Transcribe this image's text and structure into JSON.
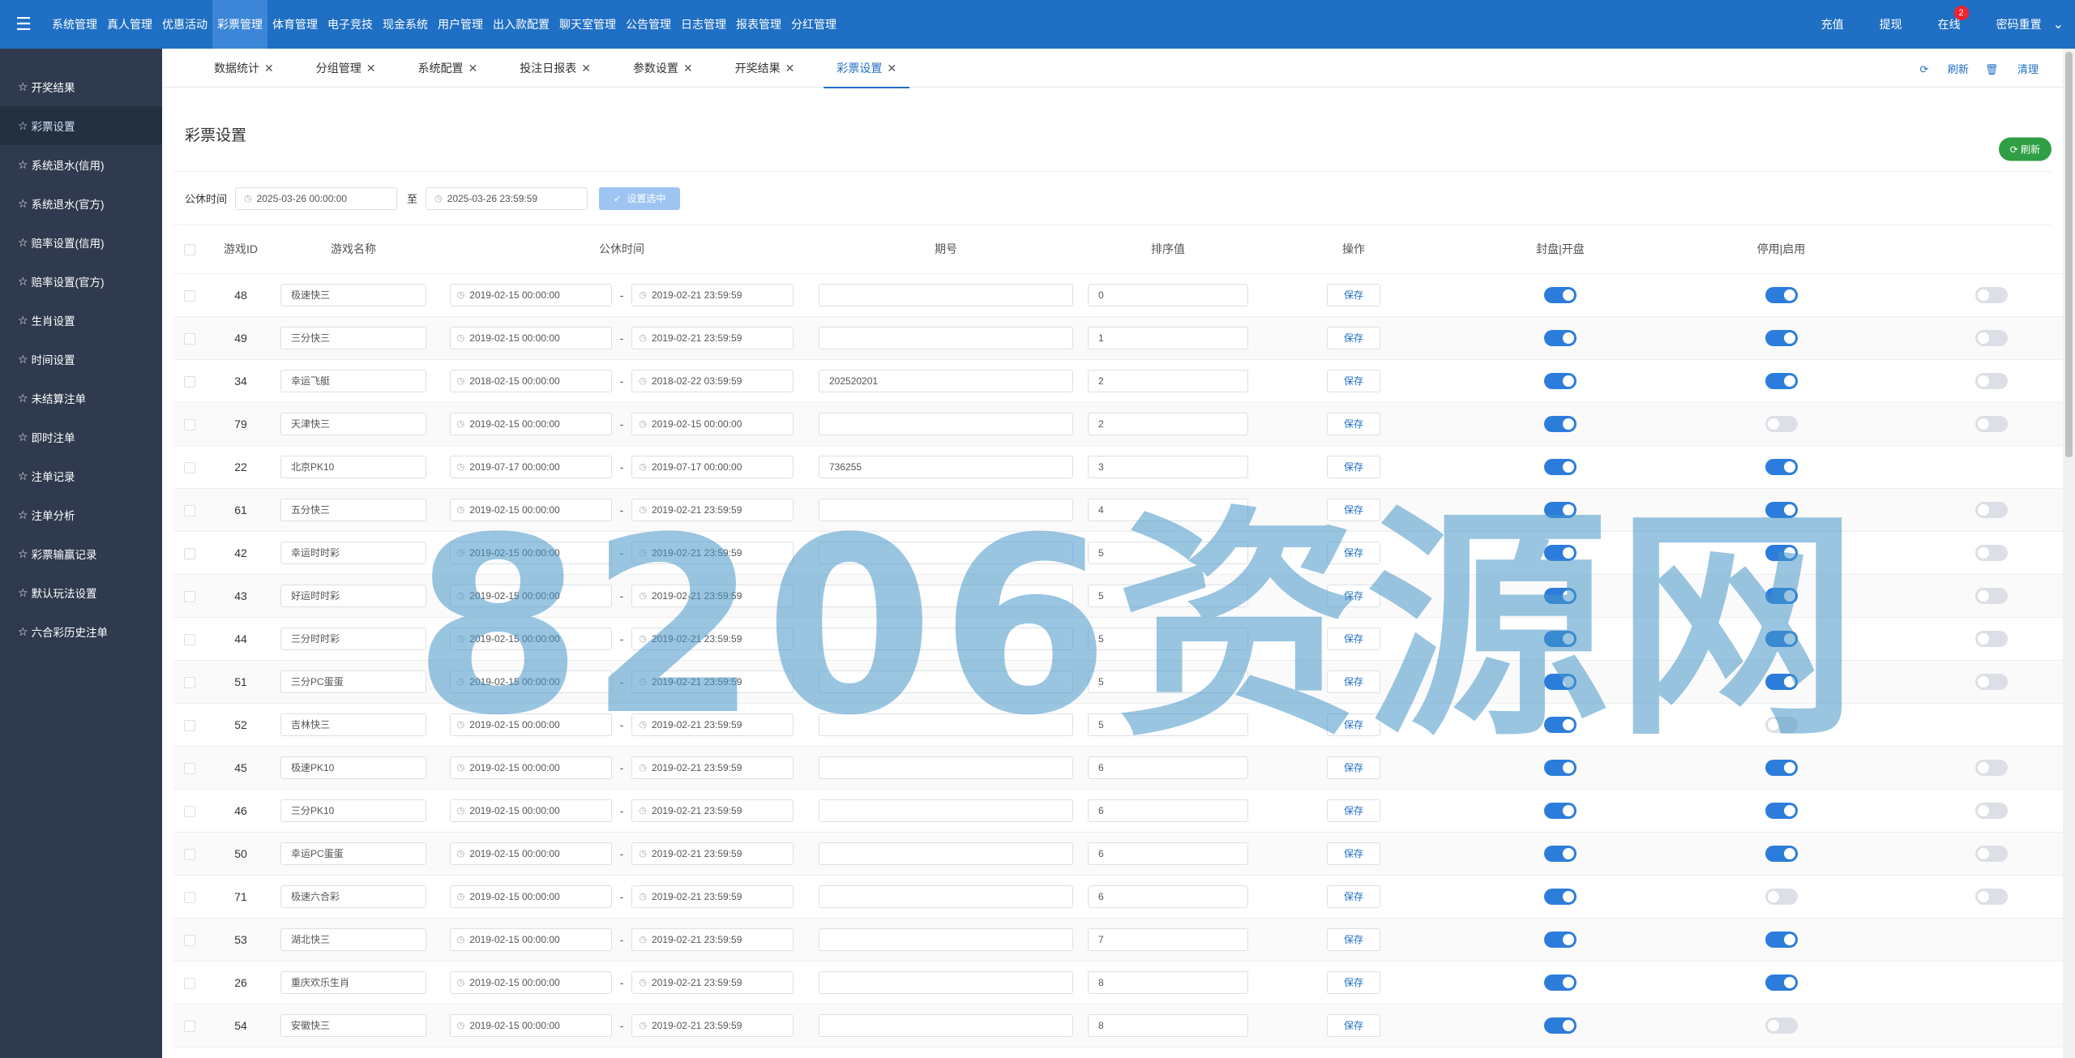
{
  "topnav": {
    "menu_icon": "hamburger-icon",
    "items": [
      {
        "label": "系统管理"
      },
      {
        "label": "真人管理"
      },
      {
        "label": "优惠活动"
      },
      {
        "label": "彩票管理"
      },
      {
        "label": "体育管理"
      },
      {
        "label": "电子竞技"
      },
      {
        "label": "现金系统"
      },
      {
        "label": "用户管理"
      },
      {
        "label": "出入款配置"
      },
      {
        "label": "聊天室管理"
      },
      {
        "label": "公告管理"
      },
      {
        "label": "日志管理"
      },
      {
        "label": "报表管理"
      },
      {
        "label": "分红管理"
      }
    ],
    "active_index": 3,
    "right": {
      "recharge": "充值",
      "withdraw": "提现",
      "online": "在线",
      "online_badge": "2",
      "password_reset": "密码重置"
    }
  },
  "sidebar": {
    "items": [
      {
        "label": "开奖结果"
      },
      {
        "label": "彩票设置"
      },
      {
        "label": "系统退水(信用)"
      },
      {
        "label": "系统退水(官方)"
      },
      {
        "label": "赔率设置(信用)"
      },
      {
        "label": "赔率设置(官方)"
      },
      {
        "label": "生肖设置"
      },
      {
        "label": "时间设置"
      },
      {
        "label": "未结算注单"
      },
      {
        "label": "即时注单"
      },
      {
        "label": "注单记录"
      },
      {
        "label": "注单分析"
      },
      {
        "label": "彩票输赢记录"
      },
      {
        "label": "默认玩法设置"
      },
      {
        "label": "六合彩历史注单"
      }
    ],
    "active_index": 1
  },
  "tabs": {
    "items": [
      {
        "label": "数据统计"
      },
      {
        "label": "分组管理"
      },
      {
        "label": "系统配置"
      },
      {
        "label": "投注日报表"
      },
      {
        "label": "参数设置"
      },
      {
        "label": "开奖结果"
      },
      {
        "label": "彩票设置"
      }
    ],
    "active_index": 6,
    "refresh": "刷新",
    "clear": "清理"
  },
  "page": {
    "title": "彩票设置",
    "refresh_button": "刷新"
  },
  "filter": {
    "label": "公休时间",
    "start": "2025-03-26 00:00:00",
    "to": "至",
    "end": "2025-03-26 23:59:59",
    "set_button": "设置选中"
  },
  "table": {
    "headers": {
      "id": "游戏ID",
      "name": "游戏名称",
      "rest_time": "公休时间",
      "issue": "期号",
      "sort": "排序值",
      "action": "操作",
      "seal": "封盘|开盘",
      "enable": "停用|启用"
    },
    "save_label": "保存",
    "rows": [
      {
        "id": "48",
        "name": "极速快三",
        "start": "2019-02-15 00:00:00",
        "end": "2019-02-21 23:59:59",
        "issue": "",
        "sort": "0",
        "seal": true,
        "enable": true,
        "extra": false
      },
      {
        "id": "49",
        "name": "三分快三",
        "start": "2019-02-15 00:00:00",
        "end": "2019-02-21 23:59:59",
        "issue": "",
        "sort": "1",
        "seal": true,
        "enable": true,
        "extra": false
      },
      {
        "id": "34",
        "name": "幸运飞艇",
        "start": "2018-02-15 00:00:00",
        "end": "2018-02-22 03:59:59",
        "issue": "202520201",
        "sort": "2",
        "seal": true,
        "enable": true,
        "extra": false
      },
      {
        "id": "79",
        "name": "天津快三",
        "start": "2019-02-15 00:00:00",
        "end": "2019-02-15 00:00:00",
        "issue": "",
        "sort": "2",
        "seal": true,
        "enable": false,
        "extra": false
      },
      {
        "id": "22",
        "name": "北京PK10",
        "start": "2019-07-17 00:00:00",
        "end": "2019-07-17 00:00:00",
        "issue": "736255",
        "sort": "3",
        "seal": true,
        "enable": true,
        "extra": null
      },
      {
        "id": "61",
        "name": "五分快三",
        "start": "2019-02-15 00:00:00",
        "end": "2019-02-21 23:59:59",
        "issue": "",
        "sort": "4",
        "seal": true,
        "enable": true,
        "extra": false
      },
      {
        "id": "42",
        "name": "幸运时时彩",
        "start": "2019-02-15 00:00:00",
        "end": "2019-02-21 23:59:59",
        "issue": "",
        "sort": "5",
        "seal": true,
        "enable": true,
        "extra": false
      },
      {
        "id": "43",
        "name": "好运时时彩",
        "start": "2019-02-15 00:00:00",
        "end": "2019-02-21 23:59:59",
        "issue": "",
        "sort": "5",
        "seal": true,
        "enable": true,
        "extra": false
      },
      {
        "id": "44",
        "name": "三分时时彩",
        "start": "2019-02-15 00:00:00",
        "end": "2019-02-21 23:59:59",
        "issue": "",
        "sort": "5",
        "seal": true,
        "enable": true,
        "extra": false
      },
      {
        "id": "51",
        "name": "三分PC蛋蛋",
        "start": "2019-02-15 00:00:00",
        "end": "2019-02-21 23:59:59",
        "issue": "",
        "sort": "5",
        "seal": true,
        "enable": true,
        "extra": false
      },
      {
        "id": "52",
        "name": "吉林快三",
        "start": "2019-02-15 00:00:00",
        "end": "2019-02-21 23:59:59",
        "issue": "",
        "sort": "5",
        "seal": true,
        "enable": false,
        "extra": null
      },
      {
        "id": "45",
        "name": "极速PK10",
        "start": "2019-02-15 00:00:00",
        "end": "2019-02-21 23:59:59",
        "issue": "",
        "sort": "6",
        "seal": true,
        "enable": true,
        "extra": false
      },
      {
        "id": "46",
        "name": "三分PK10",
        "start": "2019-02-15 00:00:00",
        "end": "2019-02-21 23:59:59",
        "issue": "",
        "sort": "6",
        "seal": true,
        "enable": true,
        "extra": false
      },
      {
        "id": "50",
        "name": "幸运PC蛋蛋",
        "start": "2019-02-15 00:00:00",
        "end": "2019-02-21 23:59:59",
        "issue": "",
        "sort": "6",
        "seal": true,
        "enable": true,
        "extra": false
      },
      {
        "id": "71",
        "name": "极速六合彩",
        "start": "2019-02-15 00:00:00",
        "end": "2019-02-21 23:59:59",
        "issue": "",
        "sort": "6",
        "seal": true,
        "enable": false,
        "extra": false
      },
      {
        "id": "53",
        "name": "湖北快三",
        "start": "2019-02-15 00:00:00",
        "end": "2019-02-21 23:59:59",
        "issue": "",
        "sort": "7",
        "seal": true,
        "enable": true,
        "extra": null
      },
      {
        "id": "26",
        "name": "重庆欢乐生肖",
        "start": "2019-02-15 00:00:00",
        "end": "2019-02-21 23:59:59",
        "issue": "",
        "sort": "8",
        "seal": true,
        "enable": true,
        "extra": null
      },
      {
        "id": "54",
        "name": "安徽快三",
        "start": "2019-02-15 00:00:00",
        "end": "2019-02-21 23:59:59",
        "issue": "",
        "sort": "8",
        "seal": true,
        "enable": false,
        "extra": null
      }
    ]
  },
  "watermark": "8206资源网"
}
